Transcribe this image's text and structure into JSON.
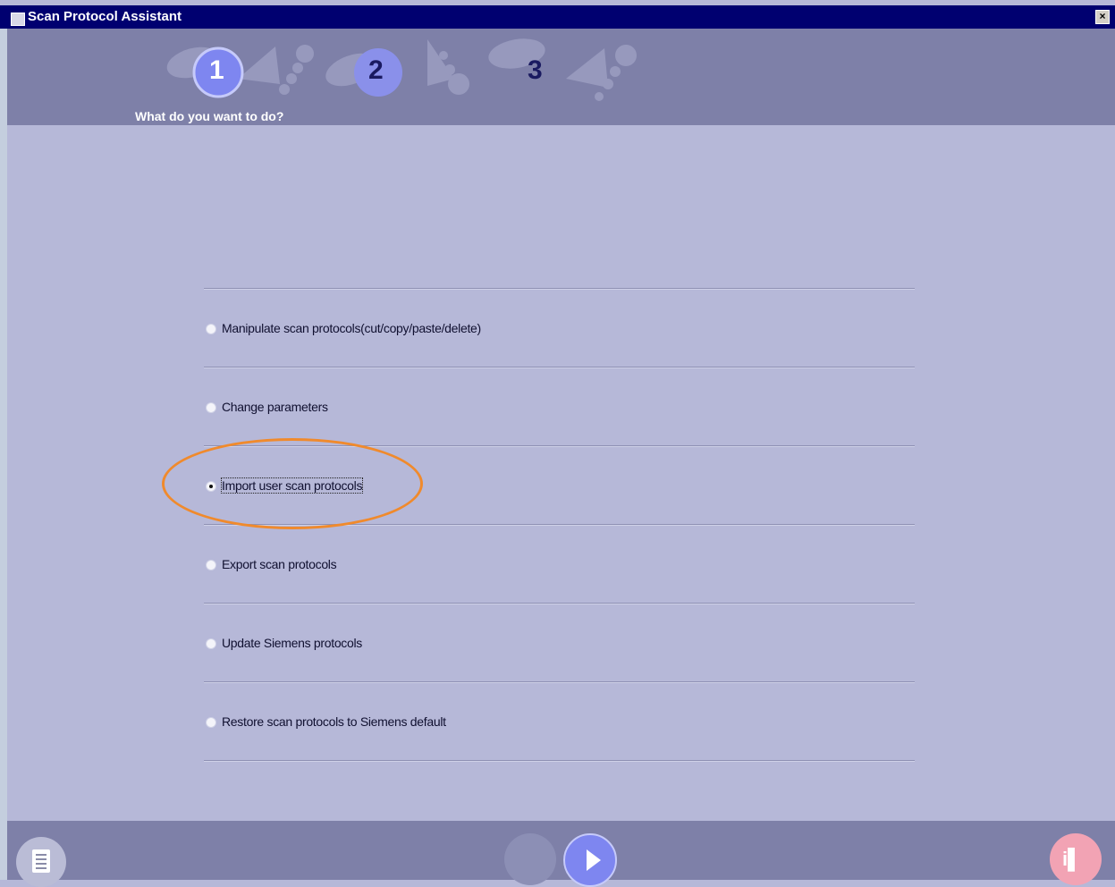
{
  "window": {
    "title": "Scan Protocol Assistant",
    "close_glyph": "×"
  },
  "wizard": {
    "steps": [
      {
        "number": "1",
        "state": "active"
      },
      {
        "number": "2",
        "state": "upcoming"
      },
      {
        "number": "3",
        "state": "upcoming"
      }
    ],
    "current_prompt": "What do you want to do?"
  },
  "options": [
    {
      "label": "Manipulate scan protocols(cut/copy/paste/delete)",
      "selected": false
    },
    {
      "label": "Change parameters",
      "selected": false
    },
    {
      "label": "Import user scan protocols",
      "selected": true
    },
    {
      "label": "Export scan protocols",
      "selected": false
    },
    {
      "label": "Update Siemens protocols",
      "selected": false
    },
    {
      "label": "Restore scan protocols to Siemens default",
      "selected": false
    }
  ],
  "footer": {
    "doc_icon": "document-icon",
    "back_icon": "back-button",
    "next_icon": "play-arrow-icon",
    "help_icon": "help-person-icon"
  },
  "colors": {
    "accent_highlight": "#f08a2c",
    "step_active": "#7e86f0",
    "background": "#b6b8d8"
  }
}
